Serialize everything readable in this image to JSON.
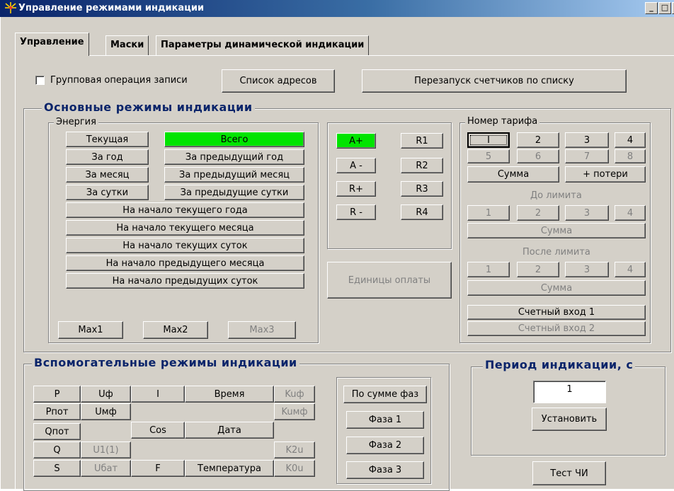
{
  "window": {
    "title": "Управление режимами индикации",
    "minimize": "_",
    "maximize": "□",
    "close": "×"
  },
  "tabs": [
    {
      "label": "Управление"
    },
    {
      "label": "Маски"
    },
    {
      "label": "Параметры динамической индикации"
    }
  ],
  "top": {
    "group_write_label": "Групповая операция записи",
    "address_list_button": "Список адресов",
    "restart_button": "Перезапуск счетчиков по списку"
  },
  "main_modes": {
    "title": "Основные режимы индикации",
    "energy": {
      "title": "Энергия",
      "current": "Текущая",
      "total": "Всего",
      "per_year": "За год",
      "prev_year": "За предыдущий год",
      "per_month": "За месяц",
      "prev_month": "За предыдущий месяц",
      "per_day": "За сутки",
      "prev_day": "За предыдущие сутки",
      "start_cur_year": "На начало текущего года",
      "start_cur_month": "На начало текущего месяца",
      "start_cur_day": "На начало текущих суток",
      "start_prev_month": "На начало предыдущего месяца",
      "start_prev_day": "На начало предыдущих суток",
      "max1": "Max1",
      "max2": "Max2",
      "max3": "Max3"
    },
    "channels": {
      "a_plus": "A+",
      "a_minus": "A -",
      "r_plus": "R+",
      "r_minus": "R -",
      "r1": "R1",
      "r2": "R2",
      "r3": "R3",
      "r4": "R4"
    },
    "payment_units": "Единицы оплаты",
    "tariff": {
      "title": "Номер тарифа",
      "t1": "I",
      "t2": "2",
      "t3": "3",
      "t4": "4",
      "t5": "5",
      "t6": "6",
      "t7": "7",
      "t8": "8",
      "sum": "Сумма",
      "plus_losses": "+ потери",
      "before_limit": "До лимита",
      "bl1": "1",
      "bl2": "2",
      "bl3": "3",
      "bl4": "4",
      "bl_sum": "Сумма",
      "after_limit": "После лимита",
      "al1": "1",
      "al2": "2",
      "al3": "3",
      "al4": "4",
      "al_sum": "Сумма",
      "count_input_1": "Счетный вход 1",
      "count_input_2": "Счетный вход 2"
    }
  },
  "aux_modes": {
    "title": "Вспомогательные режимы индикации",
    "p": "P",
    "uf": "Uф",
    "i": "I",
    "time": "Время",
    "kuf": "Kuф",
    "ppot": "Pпот",
    "umf": "Uмф",
    "kumf": "Kuмф",
    "qpot": "Qпот",
    "cos": "Cos",
    "date": "Дата",
    "q": "Q",
    "u1": "U1(1)",
    "k2u": "K2u",
    "s": "S",
    "ubat": "Uбат",
    "f": "F",
    "temperature": "Температура",
    "k0u": "K0u",
    "phase_sum": "По сумме фаз",
    "phase1": "Фаза 1",
    "phase2": "Фаза 2",
    "phase3": "Фаза 3"
  },
  "period": {
    "title": "Период индикации, с",
    "value": "1",
    "set_button": "Установить",
    "test_button": "Тест ЧИ"
  },
  "colors": {
    "active_green": "#00e400",
    "face": "#d4d0c8",
    "title_blue": "#0a246a"
  }
}
